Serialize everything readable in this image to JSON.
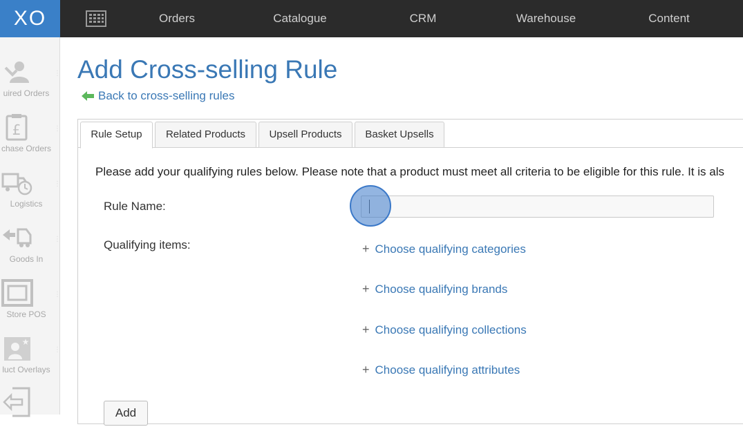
{
  "topbar": {
    "logo": "XO",
    "nav": [
      "Orders",
      "Catalogue",
      "CRM",
      "Warehouse",
      "Content"
    ]
  },
  "sidebar": {
    "items": [
      {
        "label": "uired Orders",
        "icon": "users-icon"
      },
      {
        "label": "chase Orders",
        "icon": "clipboard-pound-icon"
      },
      {
        "label": "Logistics",
        "icon": "truck-clock-icon"
      },
      {
        "label": "Goods In",
        "icon": "truck-arrow-icon"
      },
      {
        "label": "Store POS",
        "icon": "frame-icon"
      },
      {
        "label": "luct Overlays",
        "icon": "person-star-icon"
      },
      {
        "label": "",
        "icon": "exit-icon"
      }
    ]
  },
  "page": {
    "title": "Add Cross-selling Rule",
    "back_link": "Back to cross-selling rules"
  },
  "tabs": [
    {
      "label": "Rule Setup",
      "active": true
    },
    {
      "label": "Related Products",
      "active": false
    },
    {
      "label": "Upsell Products",
      "active": false
    },
    {
      "label": "Basket Upsells",
      "active": false
    }
  ],
  "form": {
    "intro": "Please add your qualifying rules below. Please note that a product must meet all criteria to be eligible for this rule. It is als",
    "rule_name_label": "Rule Name:",
    "rule_name_value": "",
    "qualifying_label": "Qualifying items:",
    "choose_links": [
      "Choose qualifying categories",
      "Choose qualifying brands",
      "Choose qualifying collections",
      "Choose qualifying attributes"
    ],
    "add_button": "Add"
  },
  "colors": {
    "accent": "#3a78b5",
    "topbar": "#2b2b2b",
    "logo_bg": "#3a80c8",
    "back_arrow": "#5cb85c"
  }
}
